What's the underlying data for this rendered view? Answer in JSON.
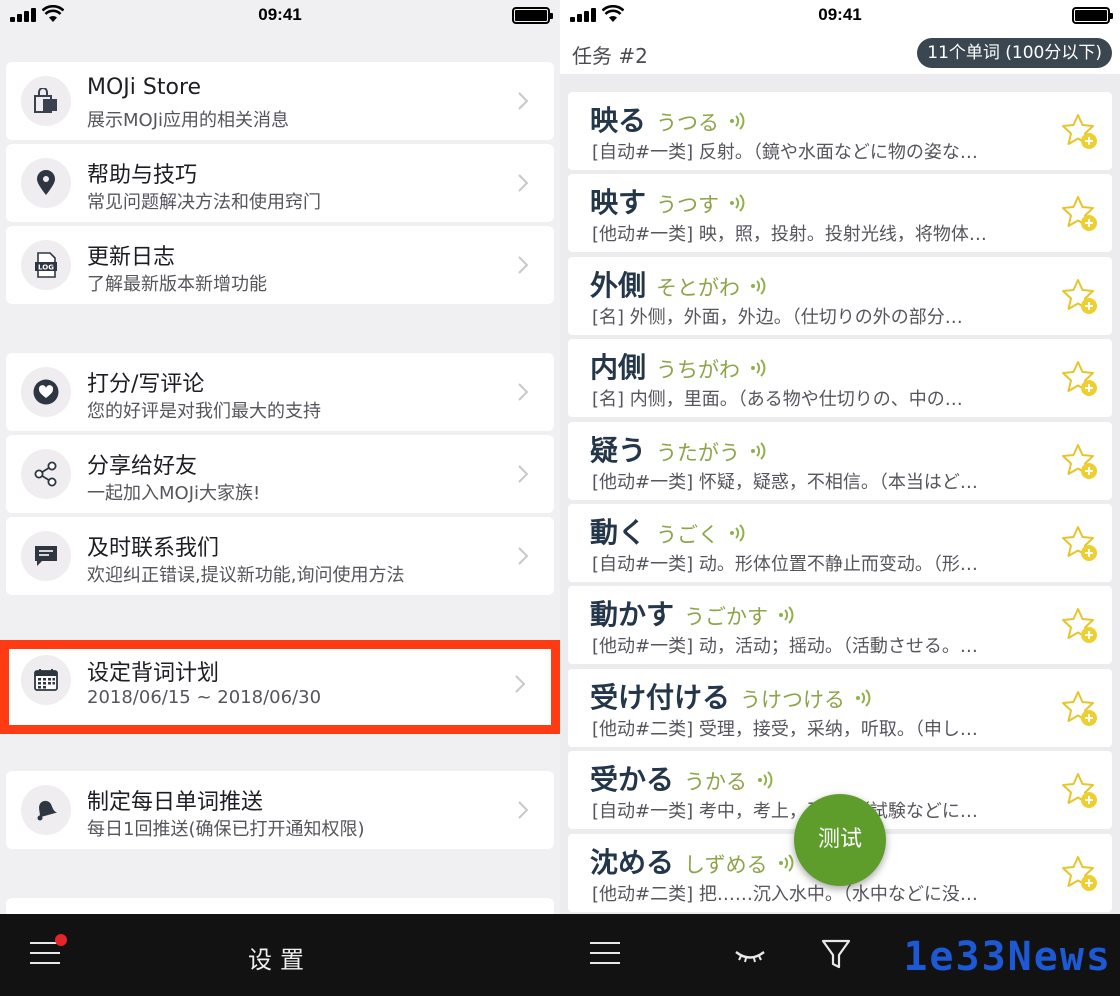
{
  "left": {
    "status": {
      "time": "09:41"
    },
    "menu": [
      {
        "title": "MOJi Store",
        "subtitle": "展示MOJi应用的相关消息",
        "icon": "store-icon"
      },
      {
        "title": "帮助与技巧",
        "subtitle": "常见问题解决方法和使用窍门",
        "icon": "location-pin-icon"
      },
      {
        "title": "更新日志",
        "subtitle": "了解最新版本新增功能",
        "icon": "log-file-icon"
      },
      {
        "title": "打分/写评论",
        "subtitle": "您的好评是对我们最大的支持",
        "icon": "heart-icon"
      },
      {
        "title": "分享给好友",
        "subtitle": "一起加入MOJi大家族!",
        "icon": "share-icon"
      },
      {
        "title": "及时联系我们",
        "subtitle": "欢迎纠正错误,提议新功能,询问使用方法",
        "icon": "chat-icon"
      },
      {
        "title": "设定背词计划",
        "subtitle": "2018/06/15 ~ 2018/06/30",
        "icon": "calendar-icon"
      },
      {
        "title": "制定每日单词推送",
        "subtitle": "每日1回推送(确保已打开通知权限)",
        "icon": "bell-icon"
      }
    ],
    "bottom_bar": {
      "title": "设置"
    }
  },
  "right": {
    "status": {
      "time": "09:41"
    },
    "header": {
      "title": "任务 #2",
      "badge": "11个单词 (100分以下)"
    },
    "words": [
      {
        "kanji": "映る",
        "kana": "うつる",
        "definition": "[自动#一类] 反射。（鏡や水面などに物の姿な…"
      },
      {
        "kanji": "映す",
        "kana": "うつす",
        "definition": "[他动#一类] 映，照，投射。投射光线，将物体…"
      },
      {
        "kanji": "外側",
        "kana": "そとがわ",
        "definition": "[名] 外侧，外面，外边。（仕切りの外の部分…"
      },
      {
        "kanji": "内側",
        "kana": "うちがわ",
        "definition": "[名] 内侧，里面。（ある物や仕切りの、中の…"
      },
      {
        "kanji": "疑う",
        "kana": "うたがう",
        "definition": "[他动#一类] 怀疑，疑惑，不相信。（本当はど…"
      },
      {
        "kanji": "動く",
        "kana": "うごく",
        "definition": "[自动#一类] 动。形体位置不静止而变动。（形…"
      },
      {
        "kanji": "動かす",
        "kana": "うごかす",
        "definition": "[他动#一类] 动，活动；摇动。（活動させる。…"
      },
      {
        "kanji": "受け付ける",
        "kana": "うけつける",
        "definition": "[他动#二类] 受理，接受，采纳，听取。（申し…"
      },
      {
        "kanji": "受かる",
        "kana": "うかる",
        "definition": "[自动#一类] 考中，考上，及格。（試験などに…"
      },
      {
        "kanji": "沈める",
        "kana": "しずめる",
        "definition": "[他动#二类] 把……沉入水中。（水中などに没…"
      }
    ],
    "fab_label": "测试",
    "watermark": "1e33News"
  },
  "colors": {
    "accent_green": "#5e9c2c",
    "kana_green": "#8fa44a",
    "highlight_red": "#ff3b14",
    "badge_bg": "#3a4650"
  }
}
